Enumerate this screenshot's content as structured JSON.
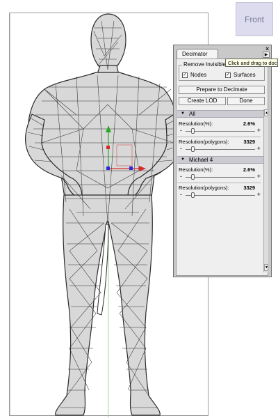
{
  "viewport": {
    "camera_label": "Front"
  },
  "decimator": {
    "tab_title": "Decimator",
    "close_glyph": "×",
    "menu_arrow_glyph": "▶",
    "tooltip": "Click and drag to doc",
    "remove_invisible_label": "Remove Invisible",
    "nodes_label": "Nodes",
    "nodes_checked": "✓",
    "surfaces_label": "Surfaces",
    "surfaces_checked": "✓",
    "prepare_button": "Prepare to Decimate",
    "create_lod_button": "Create LOD",
    "done_button": "Done",
    "sections": [
      {
        "name": "All",
        "arrow": "▼",
        "res_pct_label": "Resolution(%):",
        "res_pct_value": "2.6%",
        "res_poly_label": "Resolution(polygons):",
        "res_poly_value": "3329",
        "minus": "-",
        "plus": "+"
      },
      {
        "name": "Michael 4",
        "arrow": "▼",
        "res_pct_label": "Resolution(%):",
        "res_pct_value": "2.6%",
        "res_poly_label": "Resolution(polygons):",
        "res_poly_value": "3329",
        "minus": "-",
        "plus": "+"
      }
    ],
    "slider_fraction": 0.1,
    "scroll_up_glyph": "▲",
    "scroll_down_glyph": "▼"
  }
}
